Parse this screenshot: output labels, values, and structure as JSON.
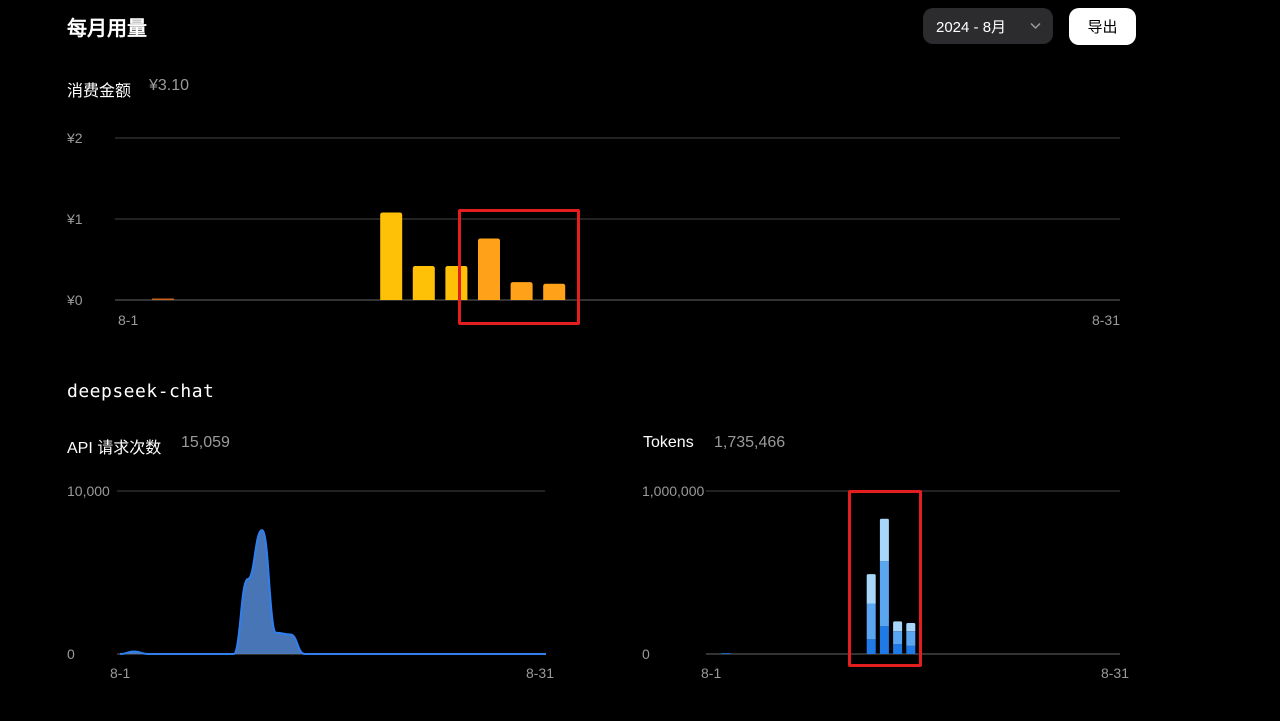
{
  "header": {
    "title": "每月用量",
    "month_select": "2024 - 8月",
    "export_label": "导出"
  },
  "cost": {
    "label": "消费金额",
    "total": "¥3.10"
  },
  "model": {
    "name": "deepseek-chat",
    "requests_label": "API 请求次数",
    "requests_total": "15,059",
    "tokens_label": "Tokens",
    "tokens_total": "1,735,466"
  },
  "colors": {
    "cost_bar": "#ffc107",
    "cost_bar_highlight": "#ffa21a",
    "requests_fill": "#4b7bc0",
    "requests_line": "#2f7ff0",
    "tokens_dark": "#1f7ae8",
    "tokens_mid": "#5aa6f0",
    "tokens_light": "#a8d6f8",
    "highlight_box": "#e41e1e",
    "gridline": "#444444"
  },
  "chart_data": [
    {
      "type": "bar",
      "name": "cost",
      "x_tick_labels": [
        "8-1",
        "8-31"
      ],
      "y_tick_labels": [
        "¥0",
        "¥1",
        "¥2"
      ],
      "ylim": [
        0,
        2
      ],
      "grid": true,
      "categories": [
        "8-2",
        "8-9",
        "8-10",
        "8-11",
        "8-12",
        "8-13",
        "8-14"
      ],
      "values": [
        0.01,
        1.08,
        0.42,
        0.42,
        0.76,
        0.22,
        0.2
      ],
      "highlighted_categories": [
        "8-12",
        "8-13",
        "8-14"
      ]
    },
    {
      "type": "area",
      "name": "api_requests",
      "x_tick_labels": [
        "8-1",
        "8-31"
      ],
      "y_tick_labels": [
        "0",
        "10,000"
      ],
      "ylim": [
        0,
        10000
      ],
      "grid": true,
      "x": [
        "8-1",
        "8-2",
        "8-3",
        "8-4",
        "8-5",
        "8-6",
        "8-7",
        "8-8",
        "8-9",
        "8-10",
        "8-11",
        "8-12",
        "8-13",
        "8-14",
        "8-15",
        "8-31"
      ],
      "values": [
        0,
        150,
        0,
        0,
        0,
        0,
        0,
        0,
        0,
        4600,
        7600,
        1300,
        1200,
        0,
        0,
        0
      ]
    },
    {
      "type": "bar",
      "stacked": true,
      "name": "tokens",
      "x_tick_labels": [
        "8-1",
        "8-31"
      ],
      "y_tick_labels": [
        "0",
        "1,000,000"
      ],
      "ylim": [
        0,
        1000000
      ],
      "grid": true,
      "categories": [
        "8-1",
        "8-12",
        "8-13",
        "8-14",
        "8-15"
      ],
      "series": [
        {
          "values": [
            5000,
            90000,
            170000,
            60000,
            50000
          ]
        },
        {
          "values": [
            0,
            220000,
            400000,
            80000,
            90000
          ]
        },
        {
          "values": [
            0,
            180000,
            260000,
            60000,
            50000
          ]
        }
      ],
      "highlighted_categories": [
        "8-13",
        "8-14",
        "8-15"
      ]
    }
  ]
}
